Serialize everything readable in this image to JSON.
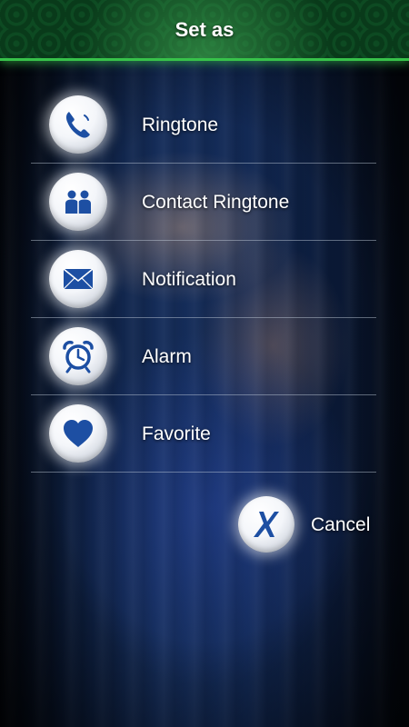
{
  "header": {
    "title": "Set as"
  },
  "menu": {
    "items": [
      {
        "label": "Ringtone",
        "icon": "phone-icon"
      },
      {
        "label": "Contact Ringtone",
        "icon": "contacts-icon"
      },
      {
        "label": "Notification",
        "icon": "envelope-icon"
      },
      {
        "label": "Alarm",
        "icon": "alarm-clock-icon"
      },
      {
        "label": "Favorite",
        "icon": "heart-icon"
      }
    ]
  },
  "cancel": {
    "label": "Cancel",
    "icon": "x-icon"
  },
  "colors": {
    "accent": "#37c24a",
    "icon_blue": "#1d4fa3"
  }
}
